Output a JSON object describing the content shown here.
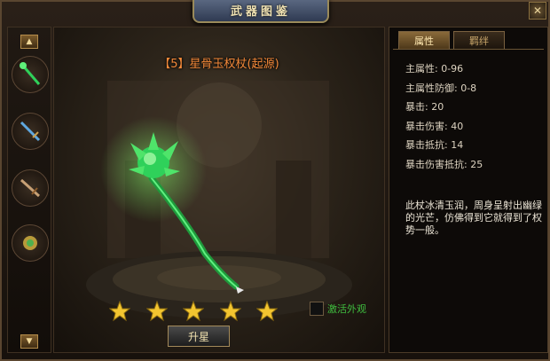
{
  "window": {
    "title": "武器图鉴",
    "close_label": "✕"
  },
  "left": {
    "scroll_up": "▲",
    "scroll_down": "▼",
    "slots": [
      {
        "icon": "green-staff-icon"
      },
      {
        "icon": "blue-blade-icon"
      },
      {
        "icon": "bronze-sword-icon"
      },
      {
        "icon": "golden-orb-icon"
      }
    ]
  },
  "weapon": {
    "name": "【5】星骨玉权杖(起源)",
    "stars": 5,
    "activate_label": "激活外观",
    "upgrade_label": "升星"
  },
  "panel": {
    "tabs": [
      {
        "label": "属性",
        "active": true
      },
      {
        "label": "羁绊",
        "active": false
      }
    ],
    "attributes": [
      "主属性: 0-96",
      "主属性防御: 0-8",
      "暴击: 20",
      "暴击伤害: 40",
      "暴击抵抗: 14",
      "暴击伤害抵抗: 25"
    ],
    "description": "此杖冰清玉润，周身呈射出幽绿的光芒，仿佛得到它就得到了权势一般。"
  },
  "colors": {
    "name_orange": "#f58a3a",
    "activate_green": "#3fbd3f",
    "jade_green": "#2fd15a"
  }
}
